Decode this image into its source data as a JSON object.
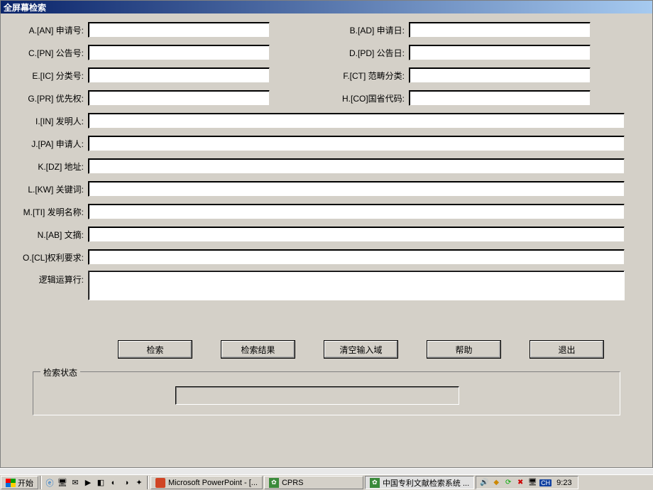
{
  "window": {
    "title": "全屏幕检索"
  },
  "fields": {
    "an": {
      "label": "A.[AN] 申请号:"
    },
    "ad": {
      "label": "B.[AD] 申请日:"
    },
    "pn": {
      "label": "C.[PN] 公告号:"
    },
    "pd": {
      "label": "D.[PD] 公告日:"
    },
    "ic": {
      "label": "E.[IC] 分类号:"
    },
    "ct": {
      "label": "F.[CT] 范畴分类:"
    },
    "pr": {
      "label": "G.[PR] 优先权:"
    },
    "co": {
      "label": "H.[CO]国省代码:"
    },
    "in_": {
      "label": "I.[IN] 发明人:"
    },
    "pa": {
      "label": "J.[PA] 申请人:"
    },
    "dz": {
      "label": "K.[DZ] 地址:"
    },
    "kw": {
      "label": "L.[KW] 关键词:"
    },
    "ti": {
      "label": "M.[TI] 发明名称:"
    },
    "ab": {
      "label": "N.[AB] 文摘:"
    },
    "cl": {
      "label": "O.[CL]权利要求:"
    },
    "logic": {
      "label": "逻辑运算行:"
    }
  },
  "buttons": {
    "search": "检索",
    "results": "检索结果",
    "clear": "清空输入域",
    "help": "帮助",
    "exit": "退出"
  },
  "status": {
    "group_label": "检索状态"
  },
  "taskbar": {
    "start": "开始",
    "tasks": [
      {
        "label": "Microsoft PowerPoint - [...",
        "icon": "pp"
      },
      {
        "label": "CPRS",
        "icon": "cprs"
      },
      {
        "label": "中国专利文献检索系统 ...",
        "icon": "cprs"
      }
    ],
    "clock": "9:23",
    "ime": "CH"
  }
}
